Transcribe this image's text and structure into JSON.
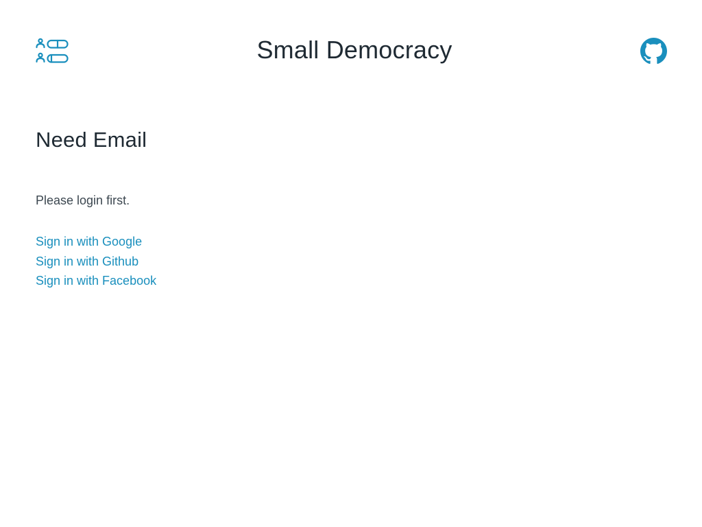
{
  "header": {
    "logo_icon": "ballot-list-icon",
    "title": "Small Democracy",
    "github_icon": "github-icon"
  },
  "main": {
    "heading": "Need Email",
    "message": "Please login first.",
    "login_links": [
      {
        "label": "Sign in with Google"
      },
      {
        "label": "Sign in with Github"
      },
      {
        "label": "Sign in with Facebook"
      }
    ]
  },
  "colors": {
    "accent": "#1a8fbd",
    "text": "#1f2a33",
    "body_text": "#3c4750",
    "background": "#ffffff"
  }
}
